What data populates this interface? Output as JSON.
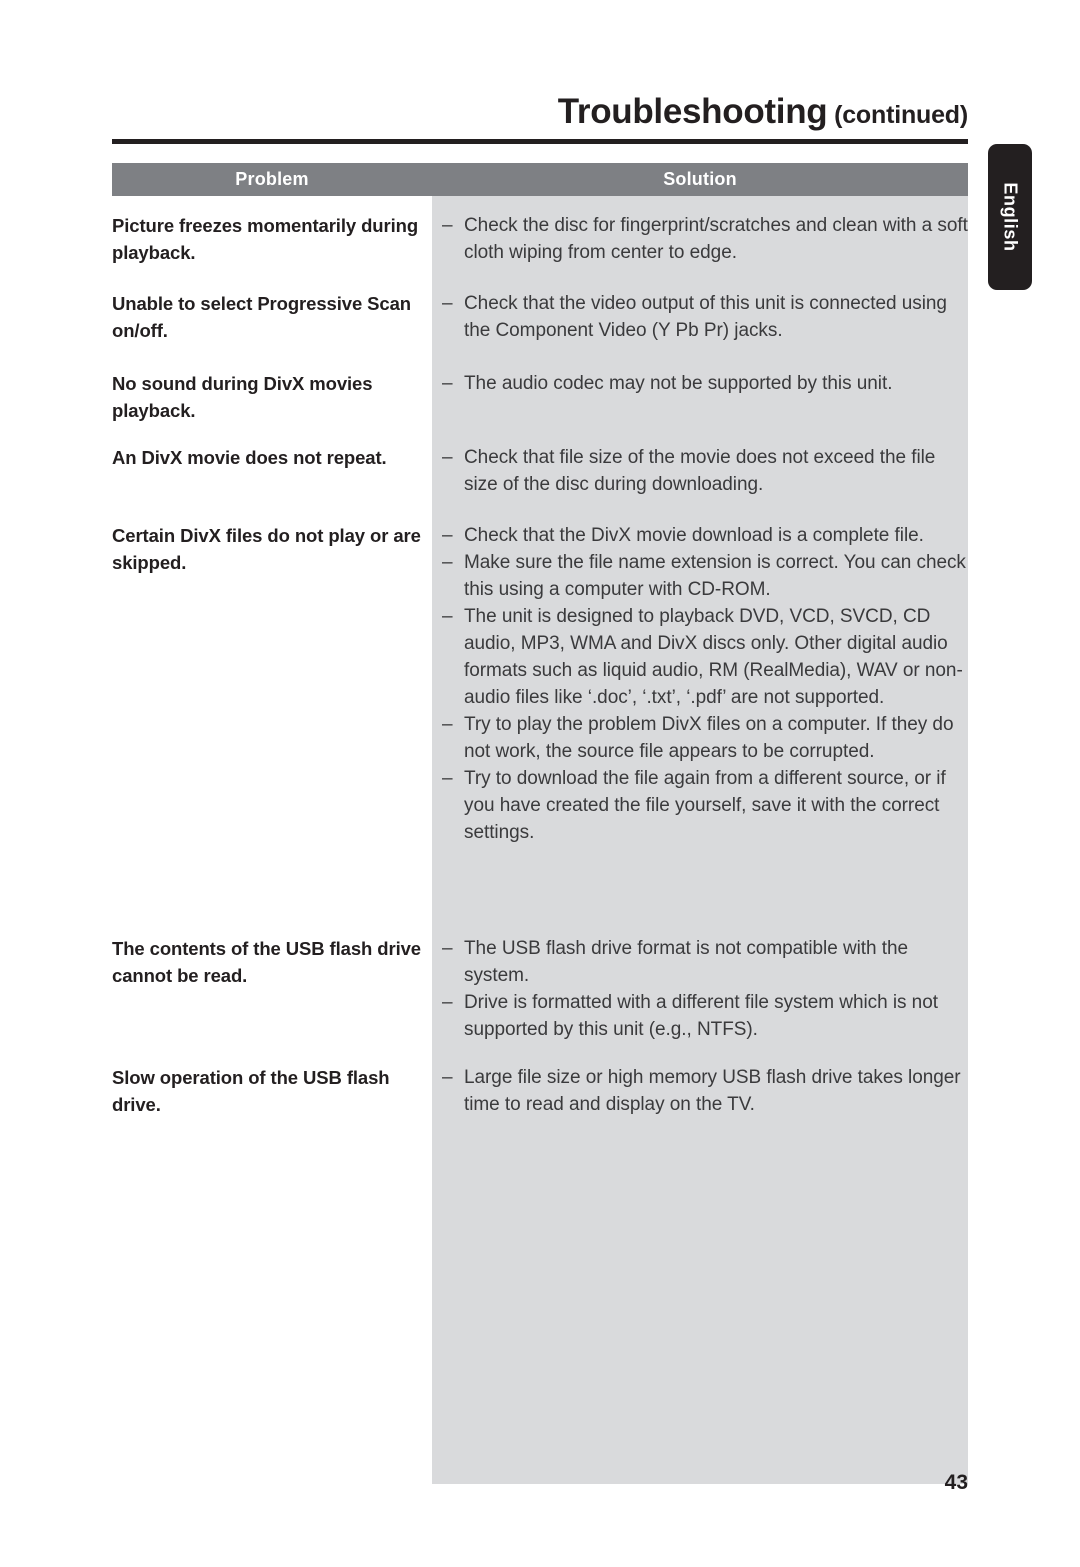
{
  "page": {
    "title_main": "Troubleshooting",
    "title_sub": " (continued)",
    "number": "43",
    "side_tab_label": "English",
    "header_bg": "#7e8084",
    "solution_bg": "#d9dadc",
    "text_color": "#231f20"
  },
  "table": {
    "headers": {
      "problem": "Problem",
      "solution": "Solution"
    },
    "dash": "–",
    "rows": [
      {
        "problem": "Picture freezes momentarily during playback.",
        "solutions": [
          "Check the disc for fingerprint/scratches and clean with a soft cloth wiping from center to edge."
        ]
      },
      {
        "problem": "Unable to select Progressive Scan on/off.",
        "solutions": [
          "Check that the video output of this unit is connected using the Component Video (Y Pb Pr) jacks."
        ]
      },
      {
        "problem": "No sound during DivX movies playback.",
        "solutions": [
          "The audio codec may not be supported by this unit."
        ]
      },
      {
        "problem": "An DivX movie does not repeat.",
        "solutions": [
          "Check that file size of the movie does not exceed the file size of the disc during downloading."
        ]
      },
      {
        "problem": "Certain DivX files do not play or are skipped.",
        "solutions": [
          "Check that the DivX movie download is a complete file.",
          "Make sure the file name extension is correct. You can check this using a computer with CD-ROM.",
          "The unit is designed to playback DVD, VCD, SVCD, CD audio, MP3, WMA and DivX discs only. Other digital audio formats such as liquid audio, RM (RealMedia), WAV or non-audio files like ‘.doc’, ‘.txt’, ‘.pdf’ are not supported.",
          "Try to play the problem DivX files on a computer. If they do not work, the source file appears to be corrupted.",
          "Try to download the file again from a different source, or if you have created the file yourself, save it with the correct settings."
        ]
      },
      {
        "problem": "The contents of the USB flash drive cannot be read.",
        "solutions": [
          "The USB flash drive format is not compatible with the system.",
          "Drive is formatted with a different file system which is not supported by this unit (e.g., NTFS)."
        ]
      },
      {
        "problem": "Slow operation of the USB flash drive.",
        "solutions": [
          "Large file size or high memory USB flash drive takes longer time to read and display on the TV."
        ]
      }
    ],
    "row_tops": [
      212,
      290,
      370,
      444,
      522,
      935,
      1064
    ]
  }
}
